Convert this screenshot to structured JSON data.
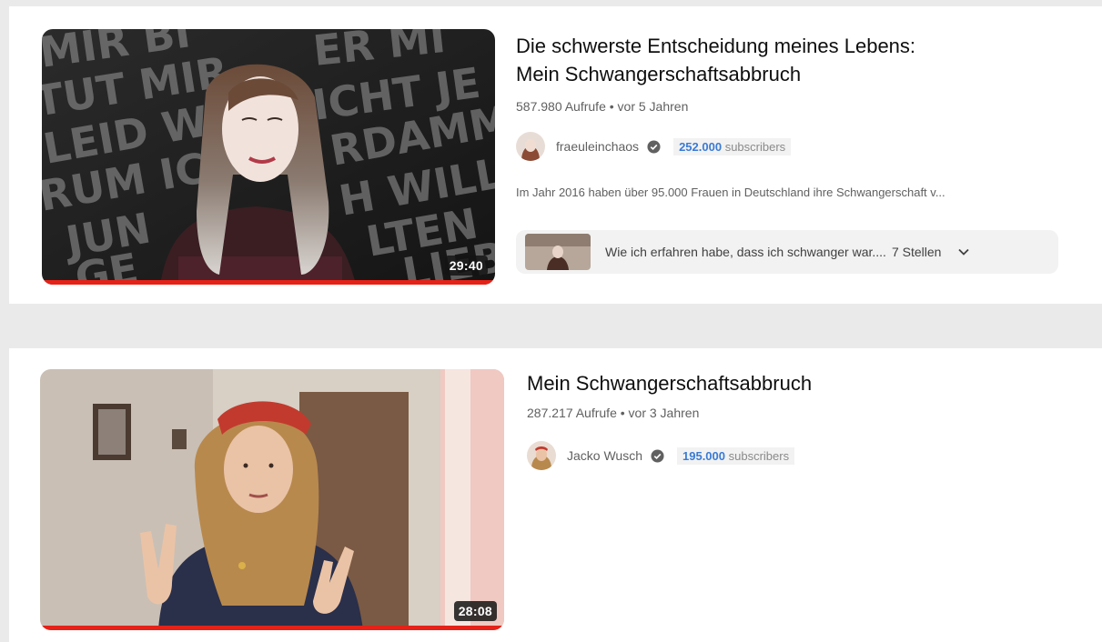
{
  "results": [
    {
      "title_line1": "Die schwerste Entscheidung meines Lebens:",
      "title_line2": "Mein Schwangerschaftsabbruch",
      "meta": "587.980 Aufrufe • vor 5 Jahren",
      "channel": "fraeuleinchaos",
      "subs_count": "252.000",
      "subs_label": "subscribers",
      "description": "Im Jahr 2016 haben über 95.000 Frauen in Deutschland ihre Schwangerschaft v...",
      "chapter_title": "Wie ich erfahren habe, dass ich schwanger war....",
      "chapter_count": "7 Stellen",
      "duration": "29:40",
      "progress": 1.0,
      "thumb_text": [
        "MIR BI",
        "ER MI",
        "TUT MIR",
        "ICHT JE",
        "LEID W",
        "RDAMM",
        "RUM IC",
        "H WILL",
        "JUN",
        "LTEN",
        "GE",
        "LIEB"
      ]
    },
    {
      "title": "Mein Schwangerschaftsabbruch",
      "meta": "287.217 Aufrufe • vor 3 Jahren",
      "channel": "Jacko Wusch",
      "subs_count": "195.000",
      "subs_label": "subscribers",
      "duration": "28:08",
      "progress": 1.0
    }
  ],
  "icons": {
    "verified": "verified-check-icon",
    "chevron": "chevron-down-icon"
  },
  "colors": {
    "accent_red": "#e62117",
    "subs_blue": "#3a7bd5"
  }
}
